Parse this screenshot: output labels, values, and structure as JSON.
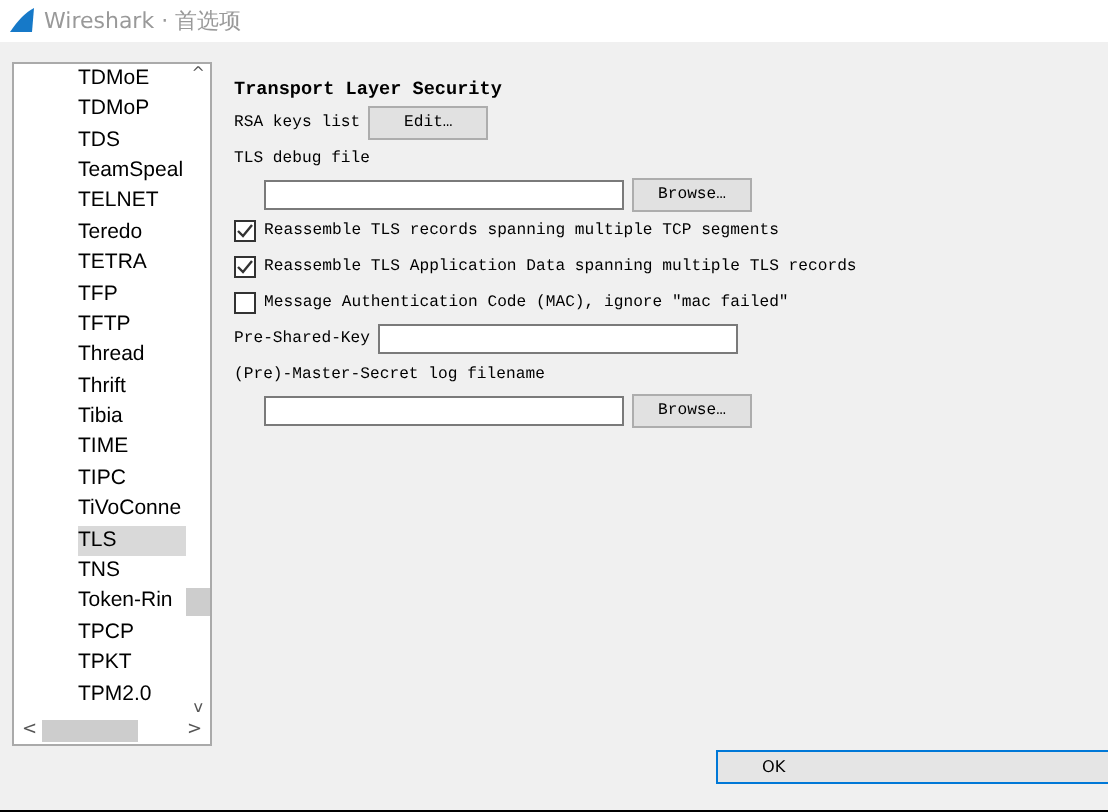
{
  "window": {
    "title": "Wireshark · 首选项"
  },
  "protocols": [
    {
      "label": "TDMoE",
      "selected": false
    },
    {
      "label": "TDMoP",
      "selected": false
    },
    {
      "label": "TDS",
      "selected": false
    },
    {
      "label": "TeamSpeal",
      "selected": false
    },
    {
      "label": "TELNET",
      "selected": false
    },
    {
      "label": "Teredo",
      "selected": false
    },
    {
      "label": "TETRA",
      "selected": false
    },
    {
      "label": "TFP",
      "selected": false
    },
    {
      "label": "TFTP",
      "selected": false
    },
    {
      "label": "Thread",
      "selected": false
    },
    {
      "label": "Thrift",
      "selected": false
    },
    {
      "label": "Tibia",
      "selected": false
    },
    {
      "label": "TIME",
      "selected": false
    },
    {
      "label": "TIPC",
      "selected": false
    },
    {
      "label": "TiVoConne",
      "selected": false
    },
    {
      "label": "TLS",
      "selected": true
    },
    {
      "label": "TNS",
      "selected": false
    },
    {
      "label": "Token-Rin",
      "selected": false
    },
    {
      "label": "TPCP",
      "selected": false
    },
    {
      "label": "TPKT",
      "selected": false
    },
    {
      "label": "TPM2.0",
      "selected": false
    }
  ],
  "scroll_arrows": {
    "up": "^",
    "down": "v",
    "left": "<",
    "right": ">"
  },
  "section_title": "Transport Layer Security",
  "settings": [
    {
      "kind": "button",
      "label": "RSA keys list",
      "button": "Edit…"
    },
    {
      "kind": "file",
      "label": "TLS debug file",
      "button": "Browse…"
    },
    {
      "kind": "checkbox",
      "label": "Reassemble TLS records spanning multiple TCP segments",
      "checked": true
    },
    {
      "kind": "checkbox",
      "label": "Reassemble TLS Application Data spanning multiple TLS records",
      "checked": true
    },
    {
      "kind": "checkbox",
      "label": "Message Authentication Code (MAC), ignore \"mac failed\"",
      "checked": false
    },
    {
      "kind": "text",
      "label": "Pre-Shared-Key"
    },
    {
      "kind": "file",
      "label": "(Pre)-Master-Secret log filename",
      "button": "Browse…"
    }
  ],
  "buttons": [
    "OK"
  ]
}
